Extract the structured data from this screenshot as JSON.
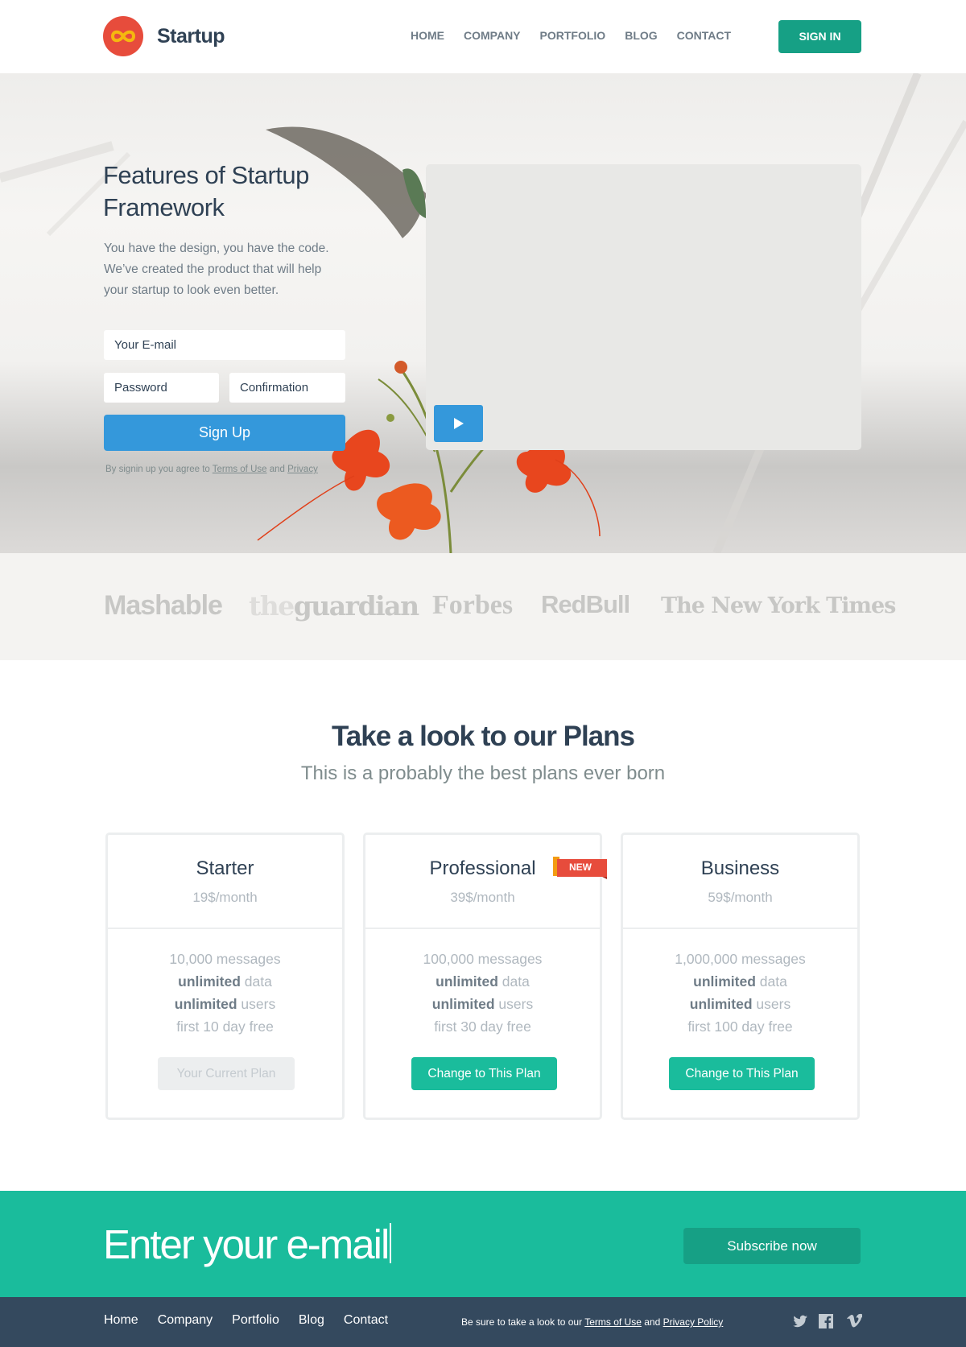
{
  "header": {
    "brand": "Startup",
    "nav": [
      "HOME",
      "COMPANY",
      "PORTFOLIO",
      "BLOG",
      "CONTACT"
    ],
    "signin_label": "SIGN IN",
    "accent": "#16a085",
    "logo_color": "#e74c3c"
  },
  "hero": {
    "title": "Features of Startup Framework",
    "text": "You have the design, you have the code. We’ve created the product that will help your startup to look even better.",
    "email_placeholder": "Your E-mail",
    "password_placeholder": "Password",
    "confirmation_placeholder": "Confirmation",
    "signup_label": "Sign Up",
    "terms_prefix": "By signin up you agree to",
    "terms_link": "Terms of Use",
    "terms_and": "and",
    "privacy_link": "Privacy",
    "video_play_icon": "play-icon",
    "button_color": "#3498db"
  },
  "press": {
    "logos": [
      "Mashable",
      "the",
      "guardian",
      "Forbes",
      "RedBull",
      "The New York Times"
    ]
  },
  "plans": {
    "title": "Take a look to our Plans",
    "subtitle": "This is a probably the best plans ever born",
    "badge": "NEW",
    "items": [
      {
        "name": "Starter",
        "price": "19$/month",
        "messages": "10,000 messages",
        "data_bold": "unlimited",
        "data_rest": "data",
        "users_bold": "unlimited",
        "users_rest": "users",
        "trial": "first 10 day free",
        "button": "Your Current Plan"
      },
      {
        "name": "Professional",
        "price": "39$/month",
        "messages": "100,000 messages",
        "data_bold": "unlimited",
        "data_rest": "data",
        "users_bold": "unlimited",
        "users_rest": "users",
        "trial": "first 30 day free",
        "button": "Change to This Plan"
      },
      {
        "name": "Business",
        "price": "59$/month",
        "messages": "1,000,000 messages",
        "data_bold": "unlimited",
        "data_rest": "data",
        "users_bold": "unlimited",
        "users_rest": "users",
        "trial": "first 100 day free",
        "button": "Change to This Plan"
      }
    ]
  },
  "subscribe": {
    "input_value": "Enter your e-mail",
    "button_label": "Subscribe now",
    "bg_color": "#1abc9c"
  },
  "footer": {
    "nav": [
      "Home",
      "Company",
      "Portfolio",
      "Blog",
      "Contact"
    ],
    "note_prefix": "Be sure to take a look to our",
    "terms_link": "Terms of Use",
    "note_and": "and",
    "privacy_link": "Privacy Policy",
    "social_icons": [
      "twitter-icon",
      "facebook-icon",
      "vimeo-icon"
    ],
    "bg_color": "#34495e"
  }
}
